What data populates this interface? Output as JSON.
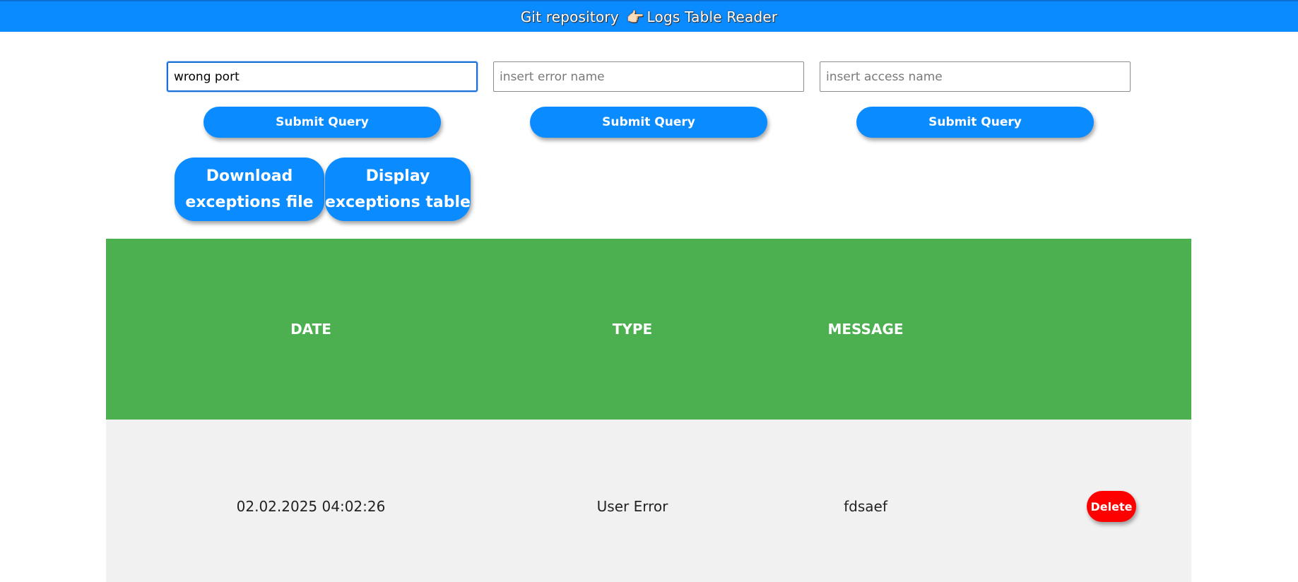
{
  "header": {
    "title_prefix": "Git repository",
    "pointer_glyph": "👉🏻",
    "title_suffix": "Logs Table Reader",
    "color": "#0a8bff"
  },
  "filters": [
    {
      "value": "wrong port",
      "placeholder": "",
      "submit_label": "Submit Query"
    },
    {
      "value": "",
      "placeholder": "insert error name",
      "submit_label": "Submit Query"
    },
    {
      "value": "",
      "placeholder": "insert access name",
      "submit_label": "Submit Query"
    }
  ],
  "actions": {
    "download_label": "Download exceptions file",
    "display_label": "Display exceptions table"
  },
  "table": {
    "header_color": "#4caf50",
    "columns": [
      "DATE",
      "TYPE",
      "MESSAGE"
    ],
    "rows": [
      {
        "date": "02.02.2025 04:02:26",
        "type": "User Error",
        "message": "fdsaef",
        "delete_label": "Delete"
      }
    ]
  },
  "colors": {
    "primary": "#0a8bff",
    "danger": "#ff0000",
    "row_bg": "#f1f1f1"
  }
}
